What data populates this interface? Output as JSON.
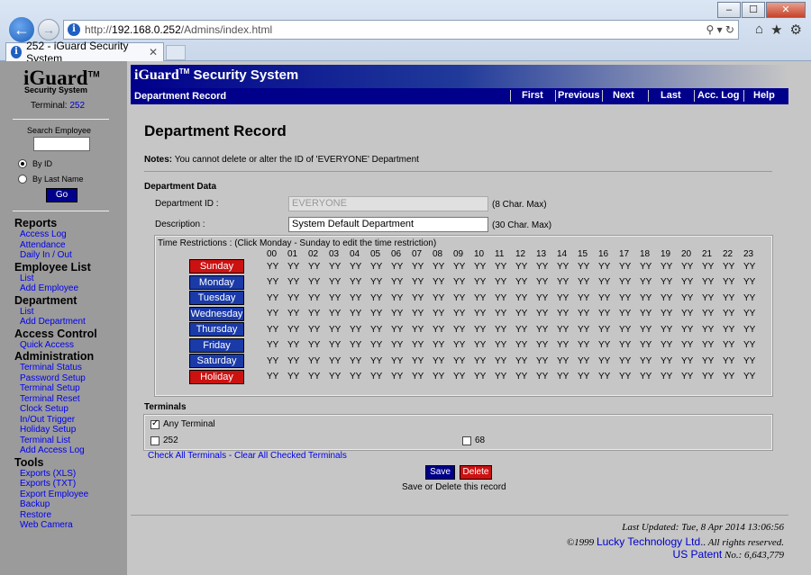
{
  "browser": {
    "url_prefix": "http://",
    "url_host": "192.168.0.252",
    "url_path": "/Admins/index.html",
    "tab_title": "252 - iGuard Security System",
    "tab_close": "✕",
    "addr_tools": "⚲ ▾ ↻",
    "right_icons": [
      "⌂",
      "★",
      "⚙"
    ],
    "window_buttons": [
      "–",
      "☐",
      "✕"
    ]
  },
  "sidebar": {
    "logo": "iGuard",
    "logo_tm": "TM",
    "logo_sub": "Security System",
    "terminal_label": "Terminal:",
    "terminal_number": "252",
    "search_label": "Search Employee",
    "search_value": "",
    "radio_by_id": "By ID",
    "radio_by_last_name": "By Last Name",
    "go_label": "Go",
    "menu": [
      {
        "heading": "Reports",
        "items": [
          "Access Log",
          "Attendance",
          "Daily In / Out"
        ]
      },
      {
        "heading": "Employee List",
        "items": [
          "List",
          "Add Employee"
        ]
      },
      {
        "heading": "Department",
        "items": [
          "List",
          "Add Department"
        ]
      },
      {
        "heading": "Access Control",
        "items": [
          "Quick Access"
        ]
      },
      {
        "heading": "Administration",
        "items": [
          "Terminal Status",
          "Password Setup",
          "Terminal Setup",
          "Terminal Reset",
          "Clock Setup",
          "In/Out Trigger",
          "Holiday Setup",
          "Terminal List",
          "Add Access Log"
        ]
      },
      {
        "heading": "Tools",
        "items": [
          "Exports (XLS)",
          "Exports (TXT)",
          "Export Employee",
          "Backup",
          "Restore",
          "Web Camera"
        ]
      }
    ]
  },
  "header": {
    "brand": "iGuard",
    "tm": "TM",
    "title_rest": " Security System",
    "section": "Department Record",
    "nav": [
      "First",
      "Previous",
      "Next",
      "Last",
      "Acc. Log",
      "Help"
    ]
  },
  "main": {
    "page_title": "Department Record",
    "notes_label": "Notes:",
    "notes_text": " You cannot delete or alter the ID of 'EVERYONE' Department",
    "dept_data_heading": "Department Data",
    "dept_id_label": "Department ID :",
    "dept_id_value": "EVERYONE",
    "dept_id_hint": "(8 Char. Max)",
    "desc_label": "Description :",
    "desc_value": "System Default Department",
    "desc_hint": "(30 Char. Max)",
    "time_restrictions_label": "Time Restrictions : (Click Monday - Sunday to edit the time restriction)",
    "hours": [
      "00",
      "01",
      "02",
      "03",
      "04",
      "05",
      "06",
      "07",
      "08",
      "09",
      "10",
      "11",
      "12",
      "13",
      "14",
      "15",
      "16",
      "17",
      "18",
      "19",
      "20",
      "21",
      "22",
      "23"
    ],
    "days": [
      {
        "name": "Sunday",
        "color": "#cc1111"
      },
      {
        "name": "Monday",
        "color": "#1a3aa8"
      },
      {
        "name": "Tuesday",
        "color": "#1a3aa8"
      },
      {
        "name": "Wednesday",
        "color": "#1a3aa8"
      },
      {
        "name": "Thursday",
        "color": "#1a3aa8"
      },
      {
        "name": "Friday",
        "color": "#1a3aa8"
      },
      {
        "name": "Saturday",
        "color": "#1a3aa8"
      },
      {
        "name": "Holiday",
        "color": "#cc1111"
      }
    ],
    "cell_value": "YY",
    "terminals_heading": "Terminals",
    "any_terminal": "Any Terminal",
    "terminal_a": "252",
    "terminal_b": "68",
    "check_all": "Check All Terminals",
    "link_sep": " - ",
    "clear_all": "Clear All Checked Terminals",
    "save_label": "Save",
    "delete_label": "Delete",
    "save_note": "Save or Delete this record"
  },
  "footer": {
    "last_updated": "Last Updated: Tue, 8 Apr 2014 13:06:56",
    "copyright_pre": "©1999 ",
    "company": "Lucky Technology Ltd.",
    "copyright_post": ". All rights reserved.",
    "patent_label": "US Patent",
    "patent_no": " No.: 6,643,779"
  }
}
